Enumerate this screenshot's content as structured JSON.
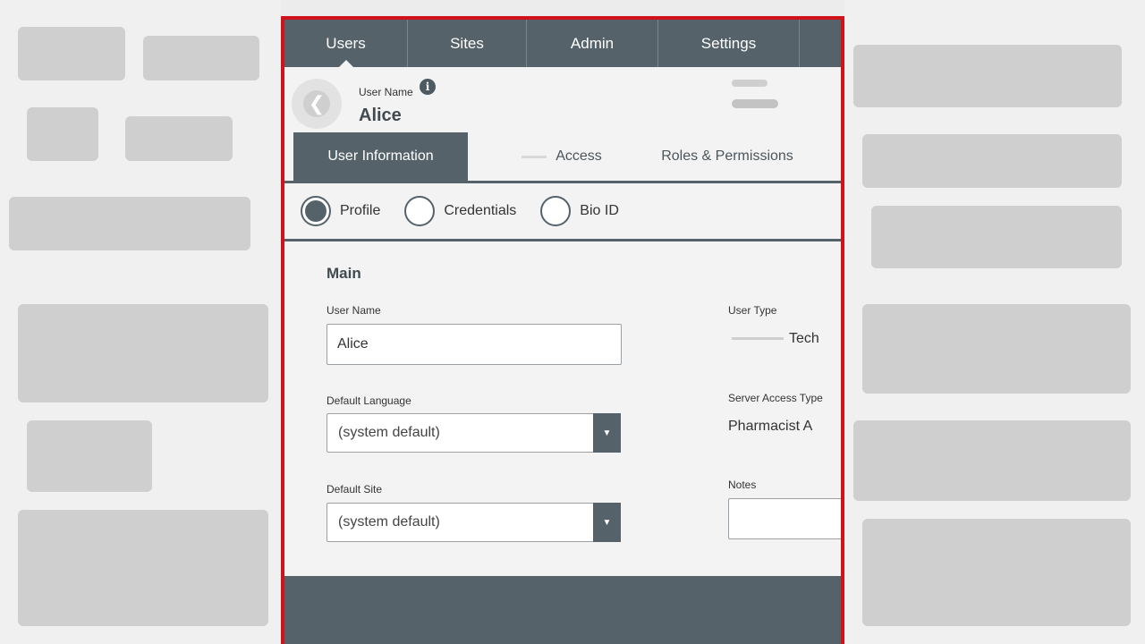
{
  "nav": {
    "items": [
      {
        "label": "Users"
      },
      {
        "label": "Sites"
      },
      {
        "label": "Admin"
      },
      {
        "label": "Settings"
      }
    ]
  },
  "header": {
    "user_name_label": "User Name",
    "user_name_value": "Alice",
    "info_icon": "info-icon",
    "info_glyph": "i"
  },
  "tabs": [
    {
      "label": "User Information",
      "active": true
    },
    {
      "label": "Access",
      "active": false
    },
    {
      "label": "Roles & Permissions",
      "active": false
    }
  ],
  "radios": [
    {
      "label": "Profile",
      "selected": true
    },
    {
      "label": "Credentials",
      "selected": false
    },
    {
      "label": "Bio ID",
      "selected": false
    }
  ],
  "main": {
    "section_title": "Main",
    "user_name": {
      "label": "User Name",
      "value": "Alice"
    },
    "default_language": {
      "label": "Default Language",
      "value": "(system default)"
    },
    "default_site": {
      "label": "Default Site",
      "value": "(system default)"
    },
    "user_type": {
      "label": "User Type",
      "value": "Tech"
    },
    "server_access_type": {
      "label": "Server Access Type",
      "value": "Pharmacist A"
    },
    "notes": {
      "label": "Notes",
      "value": ""
    }
  },
  "colors": {
    "accent": "#55626a",
    "frame": "#d0121b",
    "background": "#f3f3f3"
  }
}
